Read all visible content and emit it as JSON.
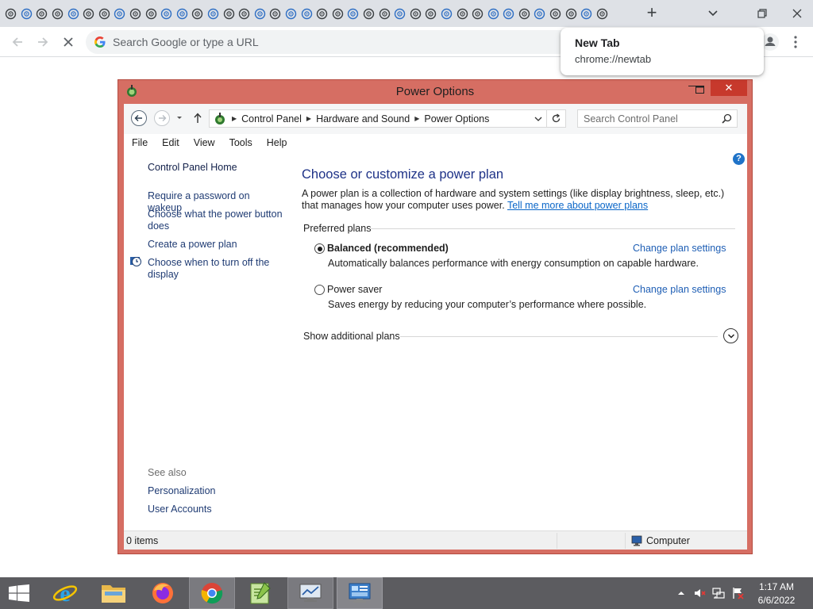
{
  "browser": {
    "tab_count": 39,
    "new_tab_symbol": "+",
    "omnibox_placeholder": "Search Google or type a URL",
    "hover_card": {
      "title": "New Tab",
      "url": "chrome://newtab"
    }
  },
  "window": {
    "title": "Power Options",
    "close_symbol": "✕",
    "minimize_symbol": "—",
    "breadcrumbs": [
      "Control Panel",
      "Hardware and Sound",
      "Power Options"
    ],
    "search_placeholder": "Search Control Panel",
    "menu": [
      "File",
      "Edit",
      "View",
      "Tools",
      "Help"
    ],
    "help_symbol": "?"
  },
  "sidebar": {
    "home": "Control Panel Home",
    "links": [
      "Require a password on wakeup",
      "Choose what the power button does",
      "Create a power plan",
      "Choose when to turn off the display"
    ],
    "see_also": "See also",
    "see_also_links": [
      "Personalization",
      "User Accounts"
    ]
  },
  "main": {
    "heading": "Choose or customize a power plan",
    "description": "A power plan is a collection of hardware and system settings (like display brightness, sleep, etc.) that manages how your computer uses power.",
    "tell_me_more": "Tell me more about power plans",
    "preferred_plans": "Preferred plans",
    "plans": [
      {
        "name": "Balanced (recommended)",
        "selected": true,
        "description": "Automatically balances performance with energy consumption on capable hardware.",
        "link": "Change plan settings"
      },
      {
        "name": "Power saver",
        "selected": false,
        "description": "Saves energy by reducing your computer’s performance where possible.",
        "link": "Change plan settings"
      }
    ],
    "show_additional": "Show additional plans"
  },
  "status": {
    "items": "0 items",
    "location": "Computer"
  },
  "taskbar": {
    "apps": [
      "start",
      "internet-explorer",
      "file-explorer",
      "firefox",
      "chrome",
      "notepad-plus-plus",
      "control-panel-window",
      "power-options"
    ],
    "time": "1:17 AM",
    "date": "6/6/2022"
  },
  "colors": {
    "window_frame": "#d66e63",
    "close_button": "#c7392c",
    "link_blue": "#1f5fb5",
    "heading_blue": "#1e3287",
    "taskbar": "#5c5c60"
  }
}
